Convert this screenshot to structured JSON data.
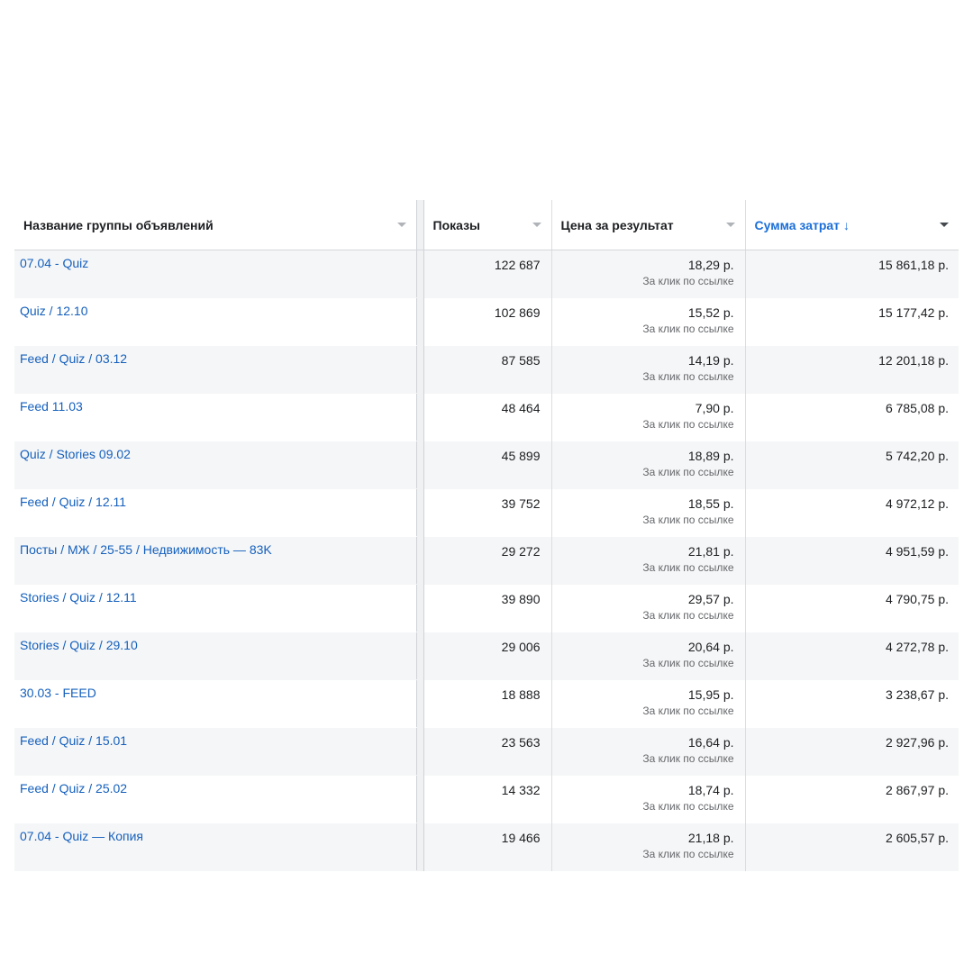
{
  "columns": {
    "name": "Название группы объявлений",
    "impressions": "Показы",
    "cost_per_result": "Цена за результат",
    "amount_spent": "Сумма затрат",
    "sort_arrow": "↓"
  },
  "rows": [
    {
      "name": "07.04 - Quiz",
      "impressions": "122 687",
      "cost": "18,29 р.",
      "cost_sub": "За клик по ссылке",
      "spent": "15 861,18 р."
    },
    {
      "name": "Quiz / 12.10",
      "impressions": "102 869",
      "cost": "15,52 р.",
      "cost_sub": "За клик по ссылке",
      "spent": "15 177,42 р."
    },
    {
      "name": "Feed / Quiz / 03.12",
      "impressions": "87 585",
      "cost": "14,19 р.",
      "cost_sub": "За клик по ссылке",
      "spent": "12 201,18 р."
    },
    {
      "name": "Feed 11.03",
      "impressions": "48 464",
      "cost": "7,90 р.",
      "cost_sub": "За клик по ссылке",
      "spent": "6 785,08 р."
    },
    {
      "name": "Quiz / Stories 09.02",
      "impressions": "45 899",
      "cost": "18,89 р.",
      "cost_sub": "За клик по ссылке",
      "spent": "5 742,20 р."
    },
    {
      "name": "Feed / Quiz / 12.11",
      "impressions": "39 752",
      "cost": "18,55 р.",
      "cost_sub": "За клик по ссылке",
      "spent": "4 972,12 р."
    },
    {
      "name": "Посты / МЖ / 25-55 / Недвижимость — 83K",
      "impressions": "29 272",
      "cost": "21,81 р.",
      "cost_sub": "За клик по ссылке",
      "spent": "4 951,59 р."
    },
    {
      "name": "Stories / Quiz / 12.11",
      "impressions": "39 890",
      "cost": "29,57 р.",
      "cost_sub": "За клик по ссылке",
      "spent": "4 790,75 р."
    },
    {
      "name": "Stories / Quiz / 29.10",
      "impressions": "29 006",
      "cost": "20,64 р.",
      "cost_sub": "За клик по ссылке",
      "spent": "4 272,78 р."
    },
    {
      "name": "30.03 - FEED",
      "impressions": "18 888",
      "cost": "15,95 р.",
      "cost_sub": "За клик по ссылке",
      "spent": "3 238,67 р."
    },
    {
      "name": "Feed / Quiz / 15.01",
      "impressions": "23 563",
      "cost": "16,64 р.",
      "cost_sub": "За клик по ссылке",
      "spent": "2 927,96 р."
    },
    {
      "name": "Feed / Quiz / 25.02",
      "impressions": "14 332",
      "cost": "18,74 р.",
      "cost_sub": "За клик по ссылке",
      "spent": "2 867,97 р."
    },
    {
      "name": "07.04 - Quiz — Копия",
      "impressions": "19 466",
      "cost": "21,18 р.",
      "cost_sub": "За клик по ссылке",
      "spent": "2 605,57 р."
    }
  ],
  "colors": {
    "link": "#1560bd",
    "sorted_header": "#1a6ed8",
    "stripe": "#f5f6f7"
  },
  "icons": {
    "column_menu": "chevron-down-icon",
    "sort": "arrow-down-icon"
  }
}
